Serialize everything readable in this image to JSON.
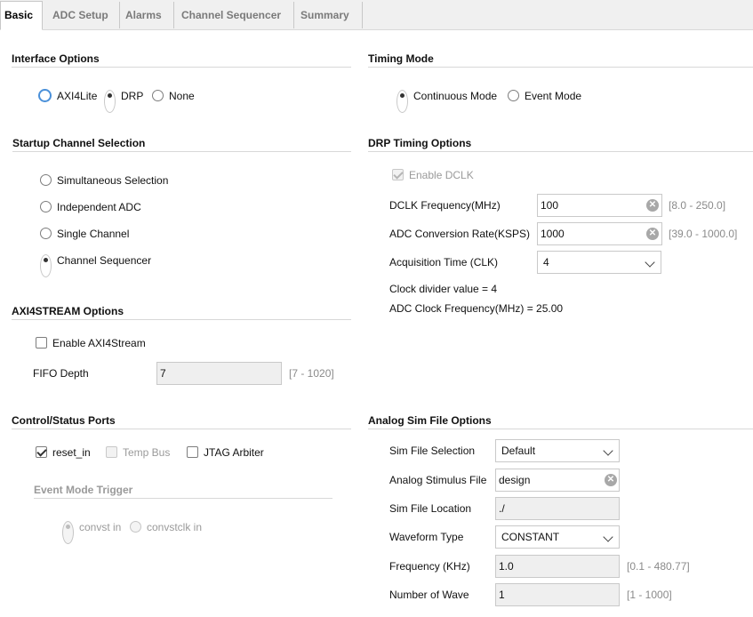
{
  "tabs": [
    "Basic",
    "ADC Setup",
    "Alarms",
    "Channel Sequencer",
    "Summary"
  ],
  "interface": {
    "title": "Interface Options",
    "options": [
      "AXI4Lite",
      "DRP",
      "None"
    ],
    "selected": "DRP"
  },
  "timing": {
    "title": "Timing Mode",
    "options": [
      "Continuous Mode",
      "Event Mode"
    ],
    "selected": "Continuous Mode"
  },
  "startup": {
    "title": "Startup Channel Selection",
    "options": [
      "Simultaneous Selection",
      "Independent ADC",
      "Single Channel",
      "Channel Sequencer"
    ],
    "selected": "Channel Sequencer"
  },
  "drp": {
    "title": "DRP Timing Options",
    "enable_dclk": "Enable DCLK",
    "dclk_label": "DCLK Frequency(MHz)",
    "dclk_value": "100",
    "dclk_range": "[8.0 - 250.0]",
    "adc_rate_label": "ADC Conversion Rate(KSPS)",
    "adc_rate_value": "1000",
    "adc_rate_range": "[39.0 - 1000.0]",
    "acq_label": "Acquisition Time (CLK)",
    "acq_value": "4",
    "clock_divider": "Clock divider value = 4",
    "adc_clock": "ADC Clock Frequency(MHz) = 25.00"
  },
  "axi4stream": {
    "title": "AXI4STREAM Options",
    "enable_label": "Enable AXI4Stream",
    "fifo_label": "FIFO Depth",
    "fifo_value": "7",
    "fifo_range": "[7 - 1020]"
  },
  "control": {
    "title": "Control/Status Ports",
    "reset_in": "reset_in",
    "temp_bus": "Temp Bus",
    "jtag": "JTAG Arbiter",
    "event_trigger_title": "Event Mode Trigger",
    "convst_in": "convst in",
    "convstclk_in": "convstclk in"
  },
  "sim": {
    "title": "Analog Sim File Options",
    "file_sel_label": "Sim File Selection",
    "file_sel_value": "Default",
    "stim_label": "Analog Stimulus File",
    "stim_value": "design",
    "loc_label": "Sim File Location",
    "loc_value": "./",
    "wave_label": "Waveform Type",
    "wave_value": "CONSTANT",
    "freq_label": "Frequency (KHz)",
    "freq_value": "1.0",
    "freq_range": "[0.1 - 480.77]",
    "num_label": "Number of Wave",
    "num_value": "1",
    "num_range": "[1 - 1000]"
  }
}
